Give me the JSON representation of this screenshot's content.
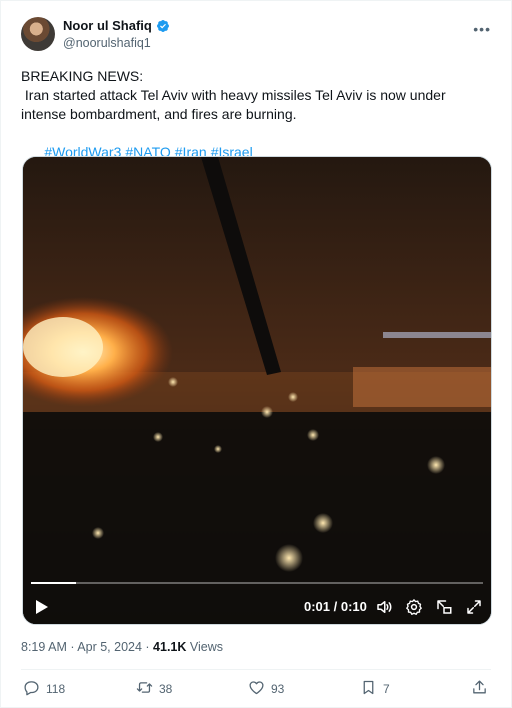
{
  "author": {
    "display_name": "Noor ul Shafiq",
    "handle": "@noorulshafiq1",
    "verified": true
  },
  "tweet": {
    "line1": "BREAKING NEWS:",
    "line2": " Iran started attack Tel Aviv with heavy missiles Tel Aviv is now under intense bombardment, and fires are burning.",
    "hashtags": [
      "#WorldWar3",
      "#NATO",
      "#Iran",
      "#Israel"
    ]
  },
  "video": {
    "time_display": "0:01 / 0:10",
    "progress_fraction": 0.1
  },
  "meta": {
    "time": "8:19 AM",
    "separator": " · ",
    "date": "Apr 5, 2024",
    "views_count": "41.1K",
    "views_label": " Views"
  },
  "actions": {
    "replies": "118",
    "reposts": "38",
    "likes": "93",
    "bookmarks": "7"
  },
  "colors": {
    "accent": "#1d9bf0",
    "secondary_text": "#536471",
    "primary_text": "#0f1419"
  },
  "icons": [
    "verified-badge-icon",
    "more-icon",
    "play-icon",
    "volume-icon",
    "settings-icon",
    "picture-in-picture-icon",
    "fullscreen-icon",
    "reply-icon",
    "repost-icon",
    "like-icon",
    "bookmark-icon",
    "share-icon"
  ]
}
